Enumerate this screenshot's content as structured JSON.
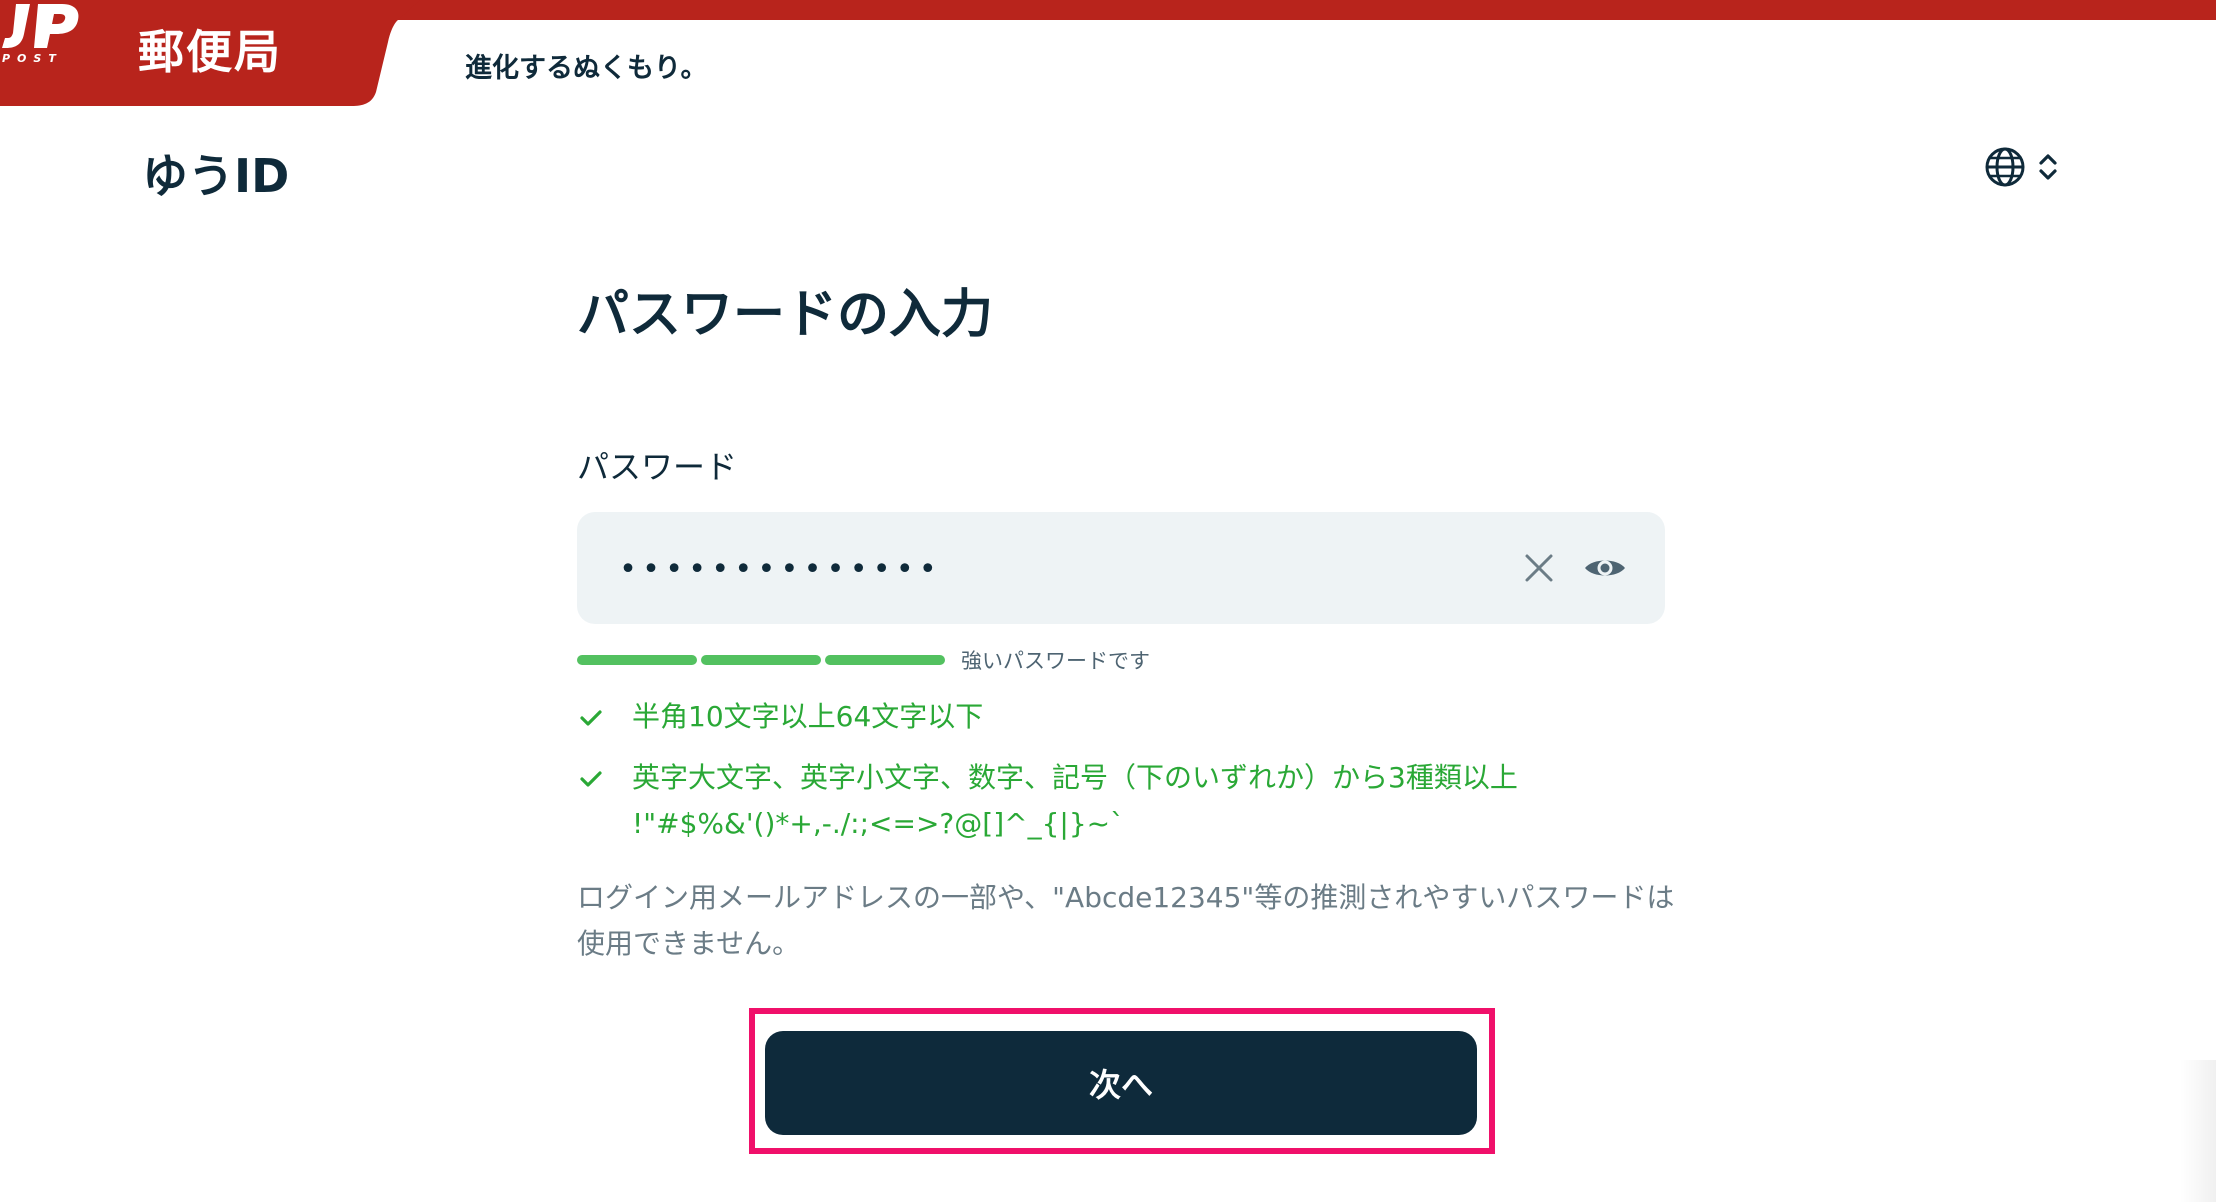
{
  "header": {
    "brand_name": "郵便局",
    "logo_text": "JP",
    "logo_sub": "POST",
    "tagline": "進化するぬくもり。",
    "service_name": "ゆうID",
    "language_icon": "globe-icon"
  },
  "form": {
    "title": "パスワードの入力",
    "password_label": "パスワード",
    "password_value": "••••••••••••••",
    "strength_segments": 3,
    "strength_text": "強いパスワードです",
    "rules": [
      {
        "text": "半角10文字以上64文字以下"
      },
      {
        "text": "英字大文字、英字小文字、数字、記号（下のいずれか）から3種類以上",
        "symbols": "!\"#$%&'()*+,-./:;<=>?@[]^_{|}~`"
      }
    ],
    "note": "ログイン用メールアドレスの一部や、\"Abcde12345\"等の推測されやすいパスワードは使用できません。",
    "next_label": "次へ"
  },
  "colors": {
    "brand_red": "#b8241c",
    "navy": "#0e2a3b",
    "success_green": "#2aa836",
    "strength_bar": "#53c160",
    "field_bg": "#eef3f5",
    "highlight": "#f0106a"
  }
}
